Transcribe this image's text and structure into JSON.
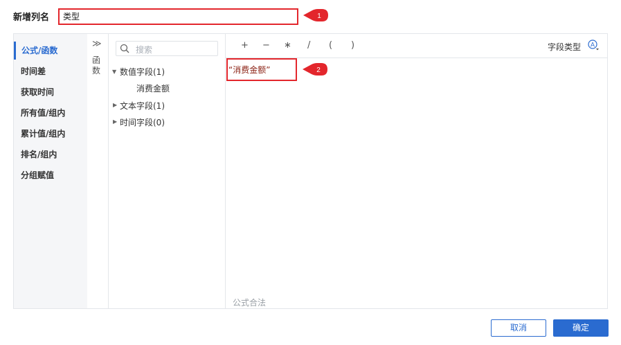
{
  "dialog": {
    "column_name_label": "新增列名",
    "column_name_value": "类型"
  },
  "markers": [
    "1",
    "2"
  ],
  "categories": [
    "公式/函数",
    "时间差",
    "获取时间",
    "所有值/组内",
    "累计值/组内",
    "排名/组内",
    "分组赋值"
  ],
  "function_panel": {
    "collapse_glyph": "≫",
    "label": "函数"
  },
  "search": {
    "placeholder": "搜索"
  },
  "tree": {
    "numeric_group": "数值字段(1)",
    "numeric_field": "消费金额",
    "text_group": "文本字段(1)",
    "time_group": "时间字段(0)"
  },
  "operators": [
    "+",
    "−",
    "∗",
    "/",
    "(",
    ")"
  ],
  "field_type": {
    "label": "字段类型",
    "icon": "A"
  },
  "formula": {
    "text": "“消费金额”"
  },
  "status": {
    "text": "公式合法"
  },
  "buttons": {
    "cancel": "取消",
    "ok": "确定"
  },
  "colors": {
    "accent": "#2a6bd0",
    "marker": "#e3262c"
  }
}
